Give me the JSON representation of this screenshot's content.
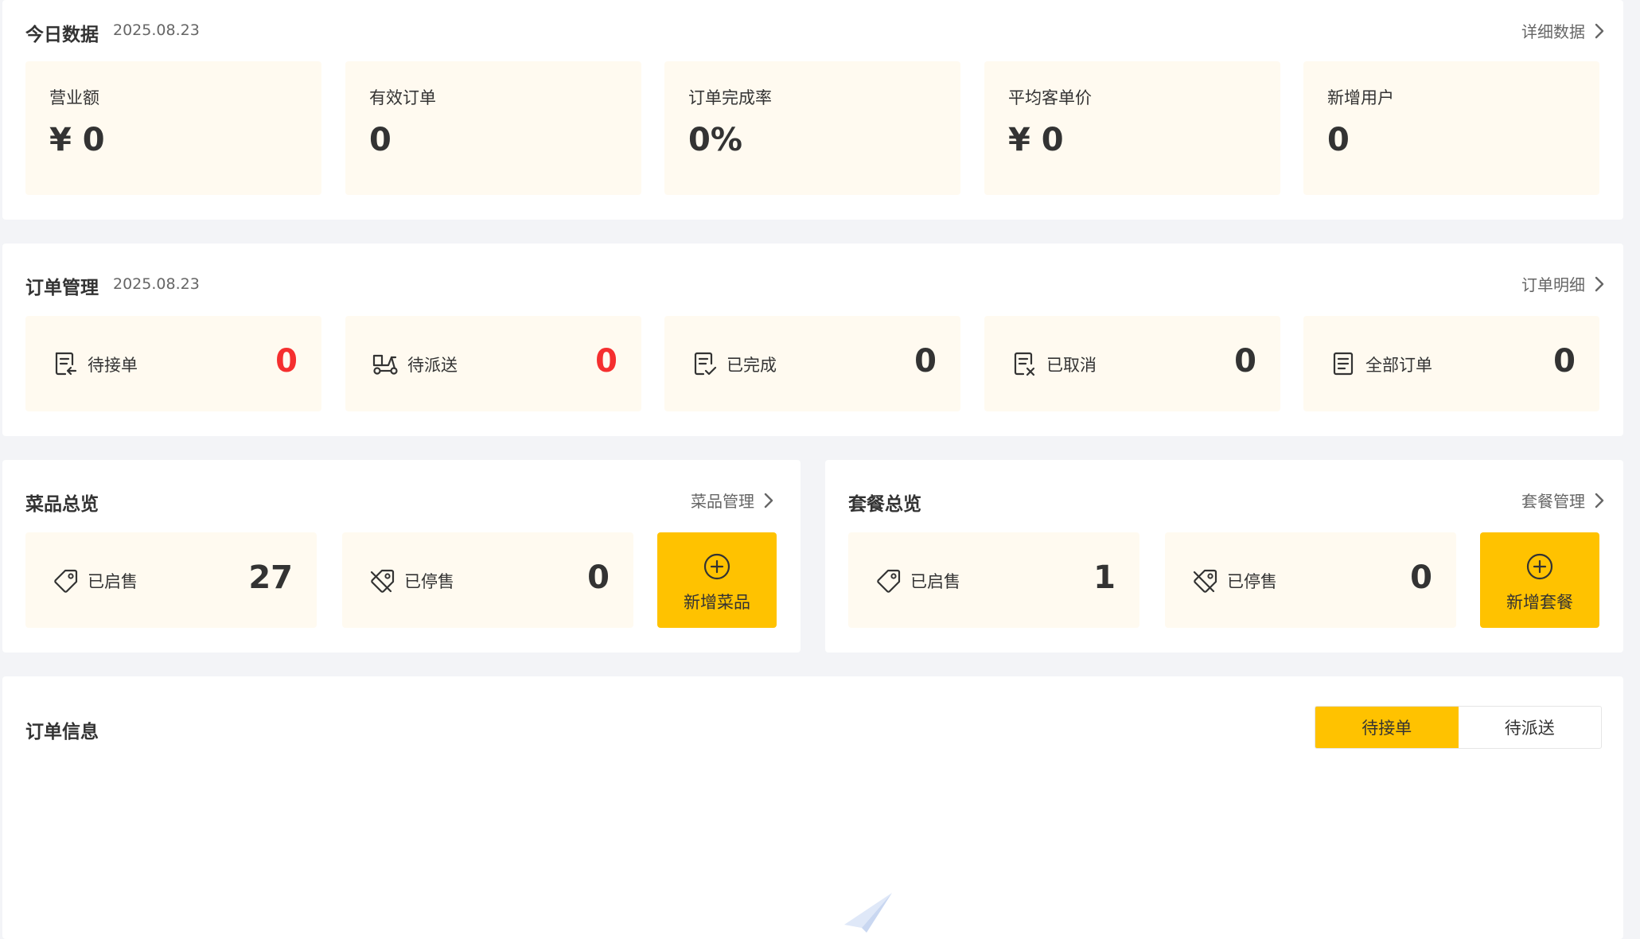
{
  "today": {
    "title": "今日数据",
    "date": "2025.08.23",
    "link": "详细数据",
    "cards": [
      {
        "label": "营业额",
        "value": "¥ 0"
      },
      {
        "label": "有效订单",
        "value": "0"
      },
      {
        "label": "订单完成率",
        "value": "0%"
      },
      {
        "label": "平均客单价",
        "value": "¥ 0"
      },
      {
        "label": "新增用户",
        "value": "0"
      }
    ]
  },
  "orders": {
    "title": "订单管理",
    "date": "2025.08.23",
    "link": "订单明细",
    "cards": [
      {
        "label": "待接单",
        "value": "0",
        "icon": "order-receive-icon",
        "alert": true
      },
      {
        "label": "待派送",
        "value": "0",
        "icon": "delivery-scooter-icon",
        "alert": true
      },
      {
        "label": "已完成",
        "value": "0",
        "icon": "order-done-icon",
        "alert": false
      },
      {
        "label": "已取消",
        "value": "0",
        "icon": "order-cancel-icon",
        "alert": false
      },
      {
        "label": "全部订单",
        "value": "0",
        "icon": "order-list-icon",
        "alert": false
      }
    ]
  },
  "dishes": {
    "title": "菜品总览",
    "link": "菜品管理",
    "on_sale": {
      "label": "已启售",
      "value": "27"
    },
    "off_sale": {
      "label": "已停售",
      "value": "0"
    },
    "add_label": "新增菜品"
  },
  "combos": {
    "title": "套餐总览",
    "link": "套餐管理",
    "on_sale": {
      "label": "已启售",
      "value": "1"
    },
    "off_sale": {
      "label": "已停售",
      "value": "0"
    },
    "add_label": "新增套餐"
  },
  "order_info": {
    "title": "订单信息",
    "tabs": [
      {
        "label": "待接单",
        "active": true
      },
      {
        "label": "待派送",
        "active": false
      }
    ]
  },
  "colors": {
    "accent": "#ffc200",
    "card_bg": "#fffaf0",
    "alert": "#f52f2f",
    "page_bg": "#f3f4f7"
  }
}
